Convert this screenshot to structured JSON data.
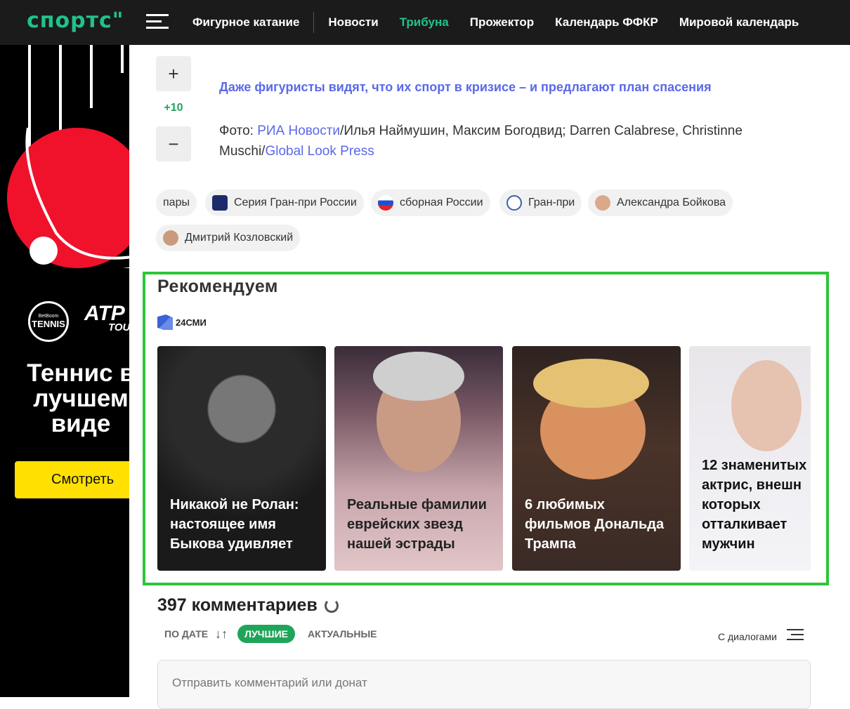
{
  "header": {
    "logo": "спортс\"",
    "nav": [
      "Фигурное катание",
      "Новости",
      "Трибуна",
      "Прожектор",
      "Календарь ФФКР",
      "Мировой календарь"
    ],
    "active_nav": "Трибуна",
    "accent_color": "#1fc38a"
  },
  "ad": {
    "brand": "BetBoom TENNIS",
    "brand_small": "BetBoom",
    "brand_main": "TENNIS",
    "partner": "ATP",
    "partner_small": "TOUR",
    "title": "Теннис в лучшем виде",
    "button": "Смотреть",
    "button_color": "#ffe000"
  },
  "vote": {
    "plus": "+",
    "score": "+10",
    "minus": "−"
  },
  "article": {
    "link": "Даже фигуристы видят, что их спорт в кризисе – и предлагают план спасения",
    "credit_prefix": "Фото: ",
    "credit_link1": "РИА Новости",
    "credit_mid": "/Илья Наймушин, Максим Богодвид; Darren Calabrese, Christinne Muschi/",
    "credit_link2": "Global Look Press"
  },
  "tags": [
    {
      "label": "пары"
    },
    {
      "label": "Серия Гран-при России"
    },
    {
      "label": "сборная России"
    },
    {
      "label": "Гран-при"
    },
    {
      "label": "Александра Бойкова"
    },
    {
      "label": "Дмитрий Козловский"
    }
  ],
  "recommend": {
    "title": "Рекомендуем",
    "source": "24СМИ",
    "cards": [
      {
        "caption": "Никакой не Ролан: настоящее имя Быкова удивляет"
      },
      {
        "caption": "Реальные фамилии еврейских звезд нашей эстрады"
      },
      {
        "caption": "6 любимых фильмов Дональда Трампа"
      },
      {
        "caption": "12 знаменитых актрис, внешн которых отталкивает мужчин"
      }
    ]
  },
  "comments": {
    "count": "397 комментариев",
    "sort_by_date": "ПО ДАТЕ",
    "sort_best": "ЛУЧШИЕ",
    "sort_actual": "АКТУАЛЬНЫЕ",
    "dialogs": "С диалогами",
    "placeholder": "Отправить комментарий или донат"
  }
}
